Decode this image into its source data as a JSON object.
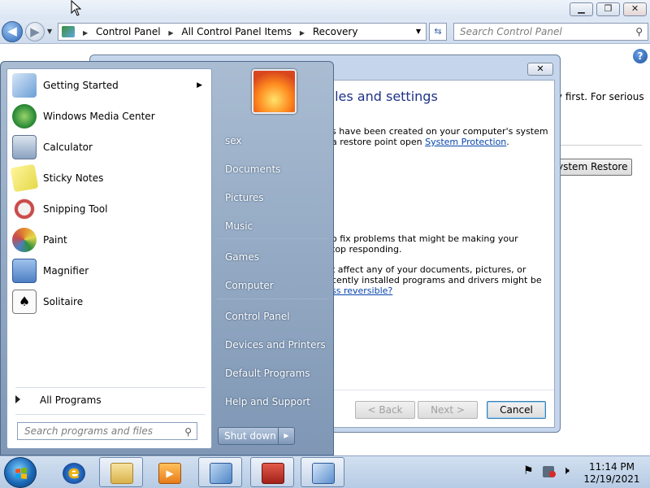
{
  "window": {
    "controls": {
      "minimize": "▁",
      "maximize": "❐",
      "close": "✕"
    },
    "breadcrumbs": [
      "Control Panel",
      "All Control Panel Items",
      "Recovery"
    ],
    "search_placeholder": "Search Control Panel",
    "help": "?",
    "partial_text": "ry first. For serious",
    "partial_button": "ystem Restore"
  },
  "dialog": {
    "close": "✕",
    "title": "files and settings",
    "line1": "s have been created on your computer's system",
    "line2_prefix": "a restore point open ",
    "line2_link": "System Protection",
    "line2_suffix": ".",
    "line3": "o fix problems that might be making your",
    "line4": "top responding.",
    "line5": "t affect any of your documents, pictures, or",
    "line6": "cently installed programs and drivers might be",
    "line7_link": "ss reversible?",
    "buttons": {
      "back": "< Back",
      "next": "Next >",
      "cancel": "Cancel"
    }
  },
  "startmenu": {
    "programs": [
      {
        "label": "Getting Started",
        "color": "#6b9ed6"
      },
      {
        "label": "Windows Media Center",
        "color": "#2f8f3a"
      },
      {
        "label": "Calculator",
        "color": "#8aa2c0"
      },
      {
        "label": "Sticky Notes",
        "color": "#e5d84a"
      },
      {
        "label": "Snipping Tool",
        "color": "#c94b4b"
      },
      {
        "label": "Paint",
        "color": "#e28b2f"
      },
      {
        "label": "Magnifier",
        "color": "#4e7fc4"
      },
      {
        "label": "Solitaire",
        "color": "#eaeaea"
      }
    ],
    "all_programs": "All Programs",
    "search_placeholder": "Search programs and files",
    "right_items": [
      {
        "label": "sex"
      },
      {
        "label": "Documents"
      },
      {
        "label": "Pictures"
      },
      {
        "label": "Music"
      },
      {
        "label": "Games"
      },
      {
        "label": "Computer"
      },
      {
        "label": "Control Panel"
      },
      {
        "label": "Devices and Printers"
      },
      {
        "label": "Default Programs"
      },
      {
        "label": "Help and Support"
      }
    ],
    "shutdown": "Shut down"
  },
  "taskbar": {
    "time": "11:14 PM",
    "date": "12/19/2021"
  }
}
